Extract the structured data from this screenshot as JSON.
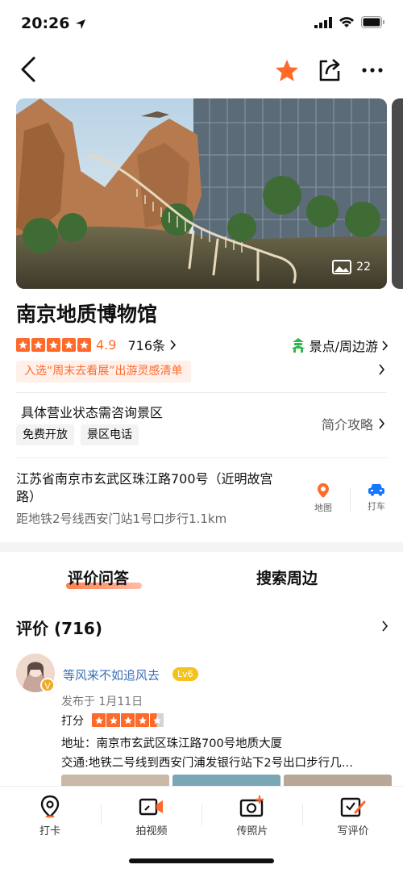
{
  "status_bar": {
    "time": "20:26"
  },
  "header": {
    "favorite_active": true
  },
  "hero": {
    "photo_count": "22"
  },
  "place": {
    "name": "南京地质博物馆",
    "rating": {
      "stars": 5,
      "score": "4.9"
    },
    "review_count": "716条",
    "category": "景点/周边游",
    "promo": "入选“周末去看展”出游灵感清单",
    "business_status": "具体营业状态需咨询景区",
    "tags": [
      "免费开放",
      "景区电话"
    ],
    "intro_link": "简介攻略",
    "address": "江苏省南京市玄武区珠江路700号（近明故宫路）",
    "metro": "距地铁2号线西安门站1号口步行1.1km",
    "actions": {
      "map": "地图",
      "taxi": "打车"
    }
  },
  "tabs": [
    "评价问答",
    "搜索周边"
  ],
  "reviews": {
    "title": "评价 (716)",
    "first": {
      "username": "等风来不如追风去",
      "level": "Lv6",
      "posted": "发布于 1月11日",
      "score_label": "打分",
      "score_stars": 4.5,
      "address_line": "地址：南京市玄武区珠江路700号地质大厦",
      "transport_line": "交通:地铁二号线到西安门浦发银行站下2号出口步行几…"
    }
  },
  "bottom_bar": [
    "打卡",
    "拍视频",
    "传照片",
    "写评价"
  ],
  "colors": {
    "accent": "#ff6a2b",
    "username": "#3b6fb6",
    "category_icon": "#2db84d",
    "action_blue": "#1677ff"
  }
}
